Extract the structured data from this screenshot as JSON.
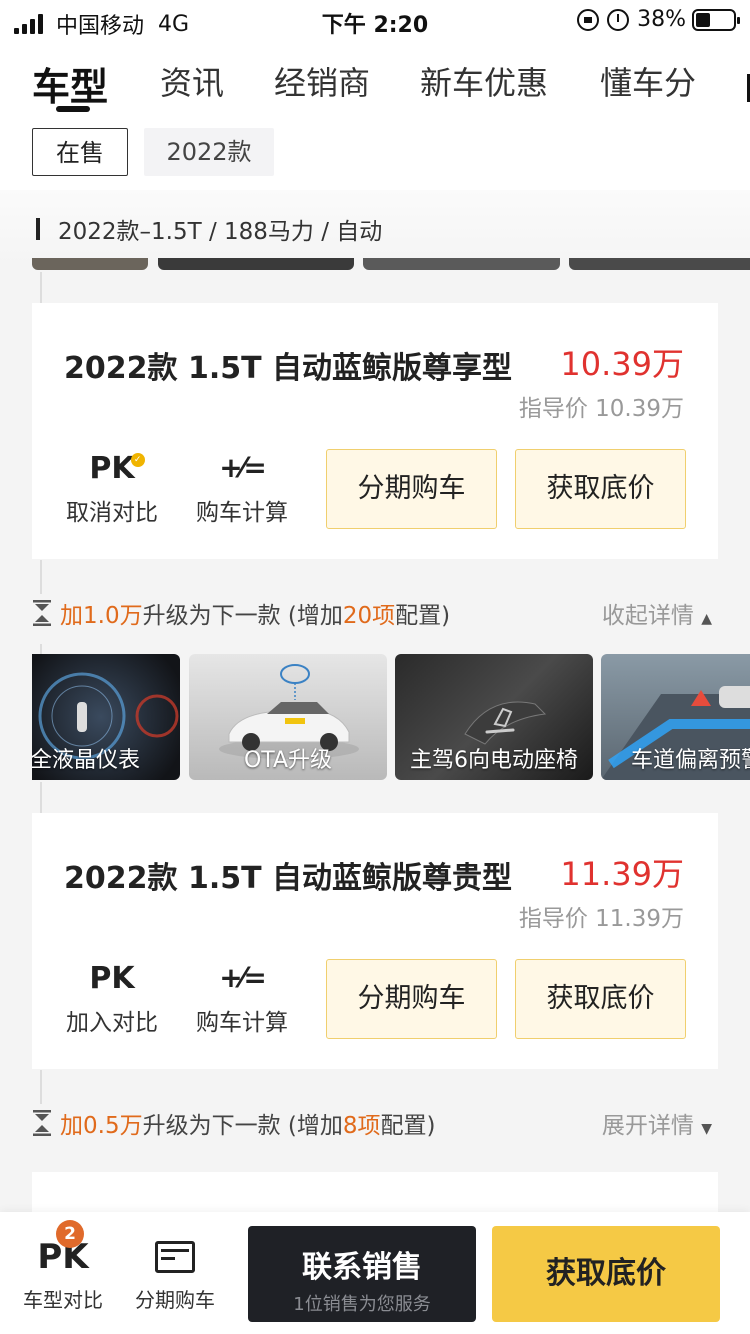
{
  "status_bar": {
    "carrier": "中国移动",
    "network": "4G",
    "time": "下午 2:20",
    "battery_percent": "38%",
    "battery_level": 0.38
  },
  "nav": {
    "tabs": [
      "车型",
      "资讯",
      "经销商",
      "新车优惠",
      "懂车分"
    ],
    "active_index": 0
  },
  "filters": {
    "chips": [
      "在售",
      "2022款"
    ],
    "selected": "在售"
  },
  "section": {
    "title": "2022款–1.5T / 188马力 / 自动"
  },
  "trims": [
    {
      "name": "2022款 1.5T 自动蓝鲸版尊享型",
      "price": "10.39万",
      "guide_price": "指导价 10.39万",
      "compare_icon": "PK",
      "compare_label": "取消对比",
      "calc_label": "购车计算",
      "loan_button": "分期购车",
      "quote_button": "获取底价"
    },
    {
      "name": "2022款 1.5T 自动蓝鲸版尊贵型",
      "price": "11.39万",
      "guide_price": "指导价 11.39万",
      "compare_icon": "PK",
      "compare_label": "加入对比",
      "calc_label": "购车计算",
      "loan_button": "分期购车",
      "quote_button": "获取底价"
    }
  ],
  "upgrades": [
    {
      "prefix": "加",
      "amount": "1.0万",
      "middle": "升级为下一款 (增加",
      "count": "20项",
      "suffix": "配置)",
      "toggle": "收起详情"
    },
    {
      "prefix": "加",
      "amount": "0.5万",
      "middle": "升级为下一款 (增加",
      "count": "8项",
      "suffix": "配置)",
      "toggle": "展开详情"
    }
  ],
  "features": [
    "全液晶仪表",
    "OTA升级",
    "主驾6向电动座椅",
    "车道偏离预警"
  ],
  "bottom_bar": {
    "compare_icon": "PK",
    "compare_badge": "2",
    "compare_label": "车型对比",
    "loan_label": "分期购车",
    "contact_title": "联系销售",
    "contact_subtitle": "1位销售为您服务",
    "quote_button": "获取底价"
  },
  "colors": {
    "price_red": "#e0322f",
    "highlight_orange": "#e06a1b",
    "accent_yellow": "#f5c945",
    "dark_button": "#1f2126"
  }
}
